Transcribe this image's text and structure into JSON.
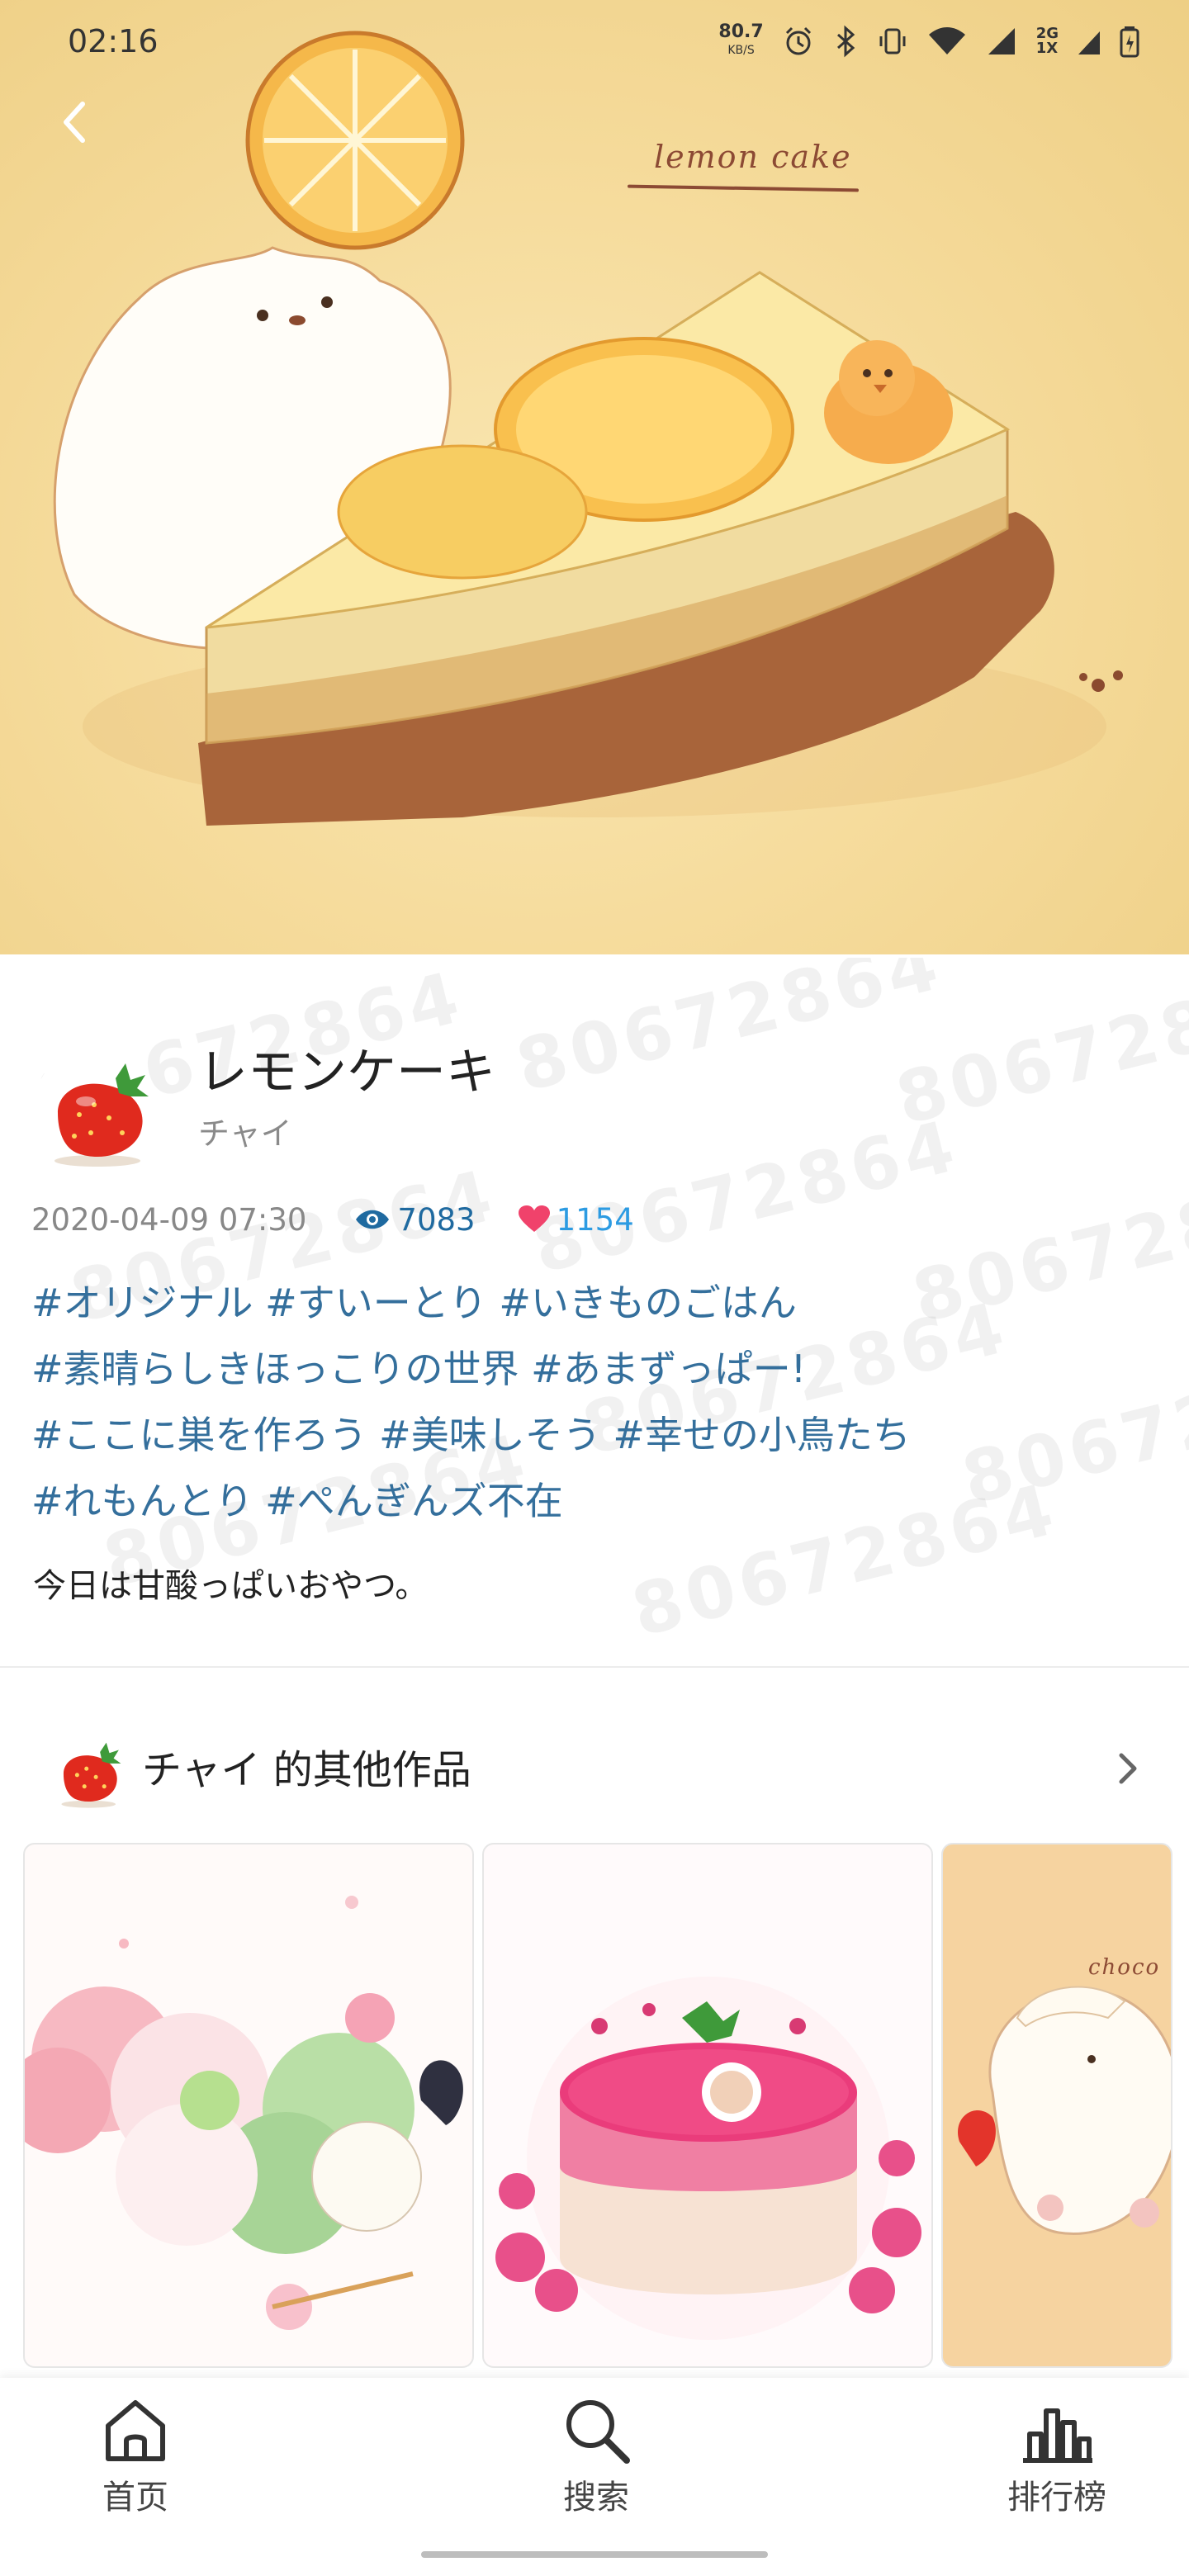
{
  "status_bar": {
    "time": "02:16",
    "net_speed": "80.7",
    "net_speed_unit": "KB/S",
    "network_line1": "2G",
    "network_line2": "1X"
  },
  "artwork": {
    "image_caption": "lemon cake",
    "title": "レモンケーキ",
    "author": "チャイ",
    "date": "2020-04-09 07:30",
    "views": "7083",
    "likes": "1154",
    "tag_lines": [
      "#オリジナル #すいーとり #いきものごはん",
      "#素晴らしきほっこりの世界 #あまずっぱー!",
      "#ここに巣を作ろう #美味しそう #幸せの小鳥たち",
      "#れもんとり #ぺんぎんズ不在"
    ],
    "description": "今日は甘酸っぱいおやつ。",
    "watermark": "80672864"
  },
  "other_works": {
    "title": "チャイ 的其他作品",
    "card3_caption": "choco"
  },
  "bottom_nav": {
    "home": "首页",
    "search": "搜索",
    "ranking": "排行榜"
  },
  "colors": {
    "tag": "#346f9c",
    "views": "#1f6aa0",
    "likes": "#2c9be2",
    "heart": "#f0426b",
    "hero_bg": "#f6dc9d"
  }
}
